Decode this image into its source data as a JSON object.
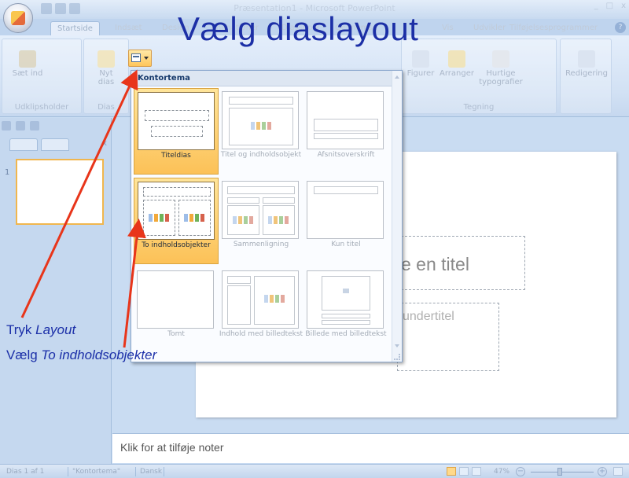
{
  "window": {
    "title": "Præsentation1 - Microsoft PowerPoint",
    "controls": [
      "_",
      "□",
      "x"
    ]
  },
  "tabs": [
    {
      "label": "Startside",
      "active": true
    },
    {
      "label": "Indsæt",
      "active": false
    },
    {
      "label": "Design",
      "active": false
    },
    {
      "label": "Animationer",
      "active": false
    },
    {
      "label": "Diasshow",
      "active": false
    },
    {
      "label": "Gennemse",
      "active": false
    },
    {
      "label": "Vis",
      "active": false
    },
    {
      "label": "Udvikler",
      "active": false
    },
    {
      "label": "Tilføjelsesprogrammer",
      "active": false
    }
  ],
  "ribbon": {
    "paste_label": "Sæt ind",
    "new_slide_label": "Nyt dias",
    "clipboard_group": "Udklipsholder",
    "slides_group": "Dias",
    "shapes_label": "Figurer",
    "arrange_label": "Arranger",
    "quickstyles_label": "Hurtige typografier",
    "drawing_group": "Tegning",
    "editing_label": "Redigering"
  },
  "layout_gallery": {
    "header": "Kontortema",
    "items": [
      {
        "label": "Titeldias",
        "selected": true
      },
      {
        "label": "Titel og indholdsobjekt",
        "selected": false
      },
      {
        "label": "Afsnitsoverskrift",
        "selected": false
      },
      {
        "label": "To indholdsobjekter",
        "selected": true
      },
      {
        "label": "Sammenligning",
        "selected": false
      },
      {
        "label": "Kun titel",
        "selected": false
      },
      {
        "label": "Tomt",
        "selected": false
      },
      {
        "label": "Indhold med billedtekst",
        "selected": false
      },
      {
        "label": "Billede med billedtekst",
        "selected": false
      }
    ]
  },
  "slide_panel": {
    "slide_number": "1"
  },
  "slide": {
    "title_placeholder": "e en titel",
    "subtitle_placeholder": "undertitel"
  },
  "notes_placeholder": "Klik for at tilføje noter",
  "status": {
    "slide": "Dias 1 af 1",
    "theme": "\"Kontortema\"",
    "language": "Dansk",
    "zoom": "47%",
    "zoom_level": 0.47
  },
  "annotation": {
    "heading": "Vælg diaslayout",
    "step1_prefix": "Tryk ",
    "step1_em": "Layout",
    "step2_prefix": "Vælg ",
    "step2_em": "To indholdsobjekter"
  },
  "colors": {
    "annotation_text": "#1c2fa6",
    "arrow": "#e8351a",
    "selection": "#fcc157"
  }
}
